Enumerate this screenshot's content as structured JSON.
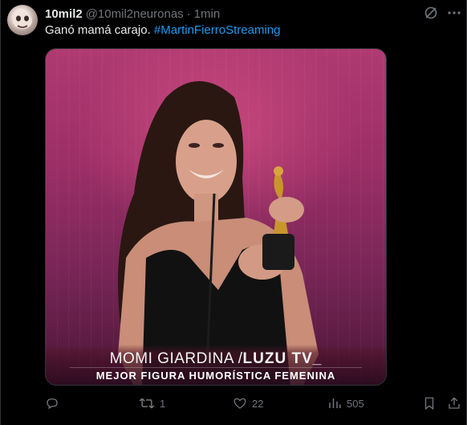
{
  "tweet": {
    "display_name": "10mil2",
    "handle": "@10mil2neuronas",
    "separator": "·",
    "time": "1min",
    "text_plain": "Ganó mamá carajo. ",
    "text_hashtag": "#MartinFierroStreaming"
  },
  "media": {
    "caption_line1_name": "MOMI GIARDINA /",
    "caption_line1_brand": "LUZU TV_",
    "caption_line2": "MEJOR FIGURA HUMORÍSTICA FEMENINA"
  },
  "actions": {
    "replies": "",
    "retweets": "1",
    "likes": "22",
    "views": "505"
  },
  "colors": {
    "background": "#000000",
    "text": "#e7e9ea",
    "muted": "#71767b",
    "link": "#1d9bf0"
  },
  "icons": [
    "grok-icon",
    "more-icon",
    "reply-icon",
    "retweet-icon",
    "like-icon",
    "views-icon",
    "bookmark-icon",
    "share-icon"
  ]
}
